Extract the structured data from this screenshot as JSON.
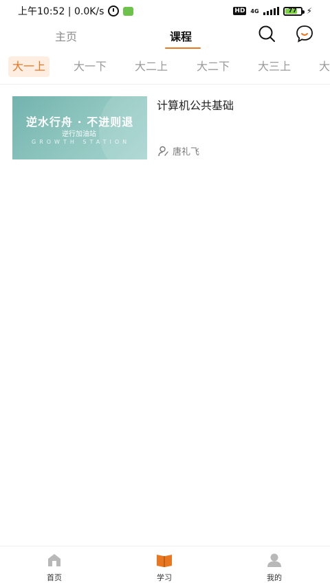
{
  "status_bar": {
    "time_text": "上午10:52 | 0.0K/s",
    "hd": "HD",
    "network": "4G",
    "battery": "77"
  },
  "top_nav": {
    "home_label": "主页",
    "course_label": "课程",
    "search_icon": "search-icon",
    "chat_icon": "chat-bubble-icon",
    "accent_color": "#e87722"
  },
  "semesters": {
    "items": [
      "大一上",
      "大一下",
      "大二上",
      "大二下",
      "大三上",
      "大"
    ],
    "selected": "大一上"
  },
  "courses": [
    {
      "title": "计算机公共基础",
      "teacher": "唐礼飞",
      "thumbnail": {
        "headline": "逆水行舟 · 不进则退",
        "subline": "逆行加油站",
        "caption": "GROWTH STATION"
      }
    }
  ],
  "bottom_nav": {
    "items": [
      {
        "label": "首页",
        "icon": "home-icon"
      },
      {
        "label": "学习",
        "icon": "book-icon"
      },
      {
        "label": "我的",
        "icon": "profile-icon"
      }
    ],
    "active": "学习"
  }
}
